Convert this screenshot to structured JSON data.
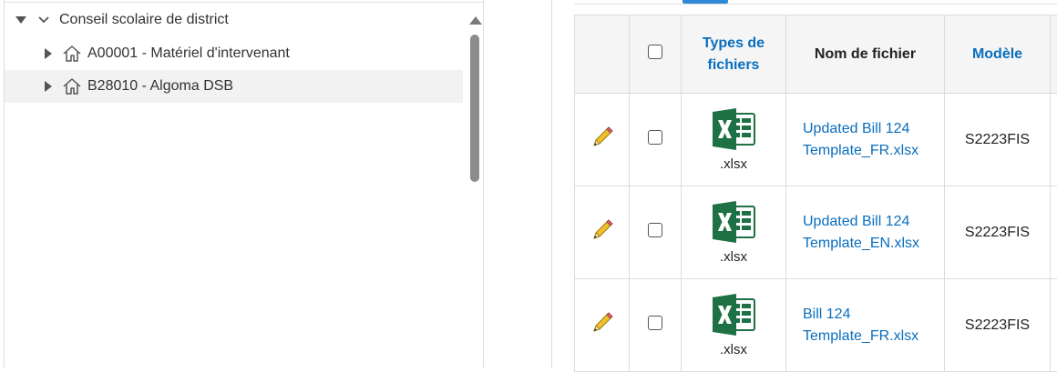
{
  "tree": {
    "root": {
      "label": "Conseil scolaire de district",
      "expanded": true
    },
    "items": [
      {
        "label": "A00001 - Matériel d'intervenant",
        "icon": "home-icon",
        "selected": false
      },
      {
        "label": "B28010 - Algoma DSB",
        "icon": "home-icon",
        "selected": true
      }
    ]
  },
  "table": {
    "headers": {
      "file_types": "Types de fichiers",
      "file_name": "Nom de fichier",
      "model": "Modèle"
    },
    "rows": [
      {
        "file_type": ".xlsx",
        "file_name": "Updated Bill 124 Template_FR.xlsx",
        "model": "S2223FIS"
      },
      {
        "file_type": ".xlsx",
        "file_name": "Updated Bill 124 Template_EN.xlsx",
        "model": "S2223FIS"
      },
      {
        "file_type": ".xlsx",
        "file_name": "Bill 124 Template_FR.xlsx",
        "model": "S2223FIS"
      }
    ]
  },
  "colors": {
    "link": "#0a6ebd",
    "excel_green": "#1e7145",
    "tab_accent": "#2f89d6"
  },
  "icons": [
    "home-icon",
    "pencil-icon",
    "excel-icon",
    "chevron-down-icon"
  ]
}
